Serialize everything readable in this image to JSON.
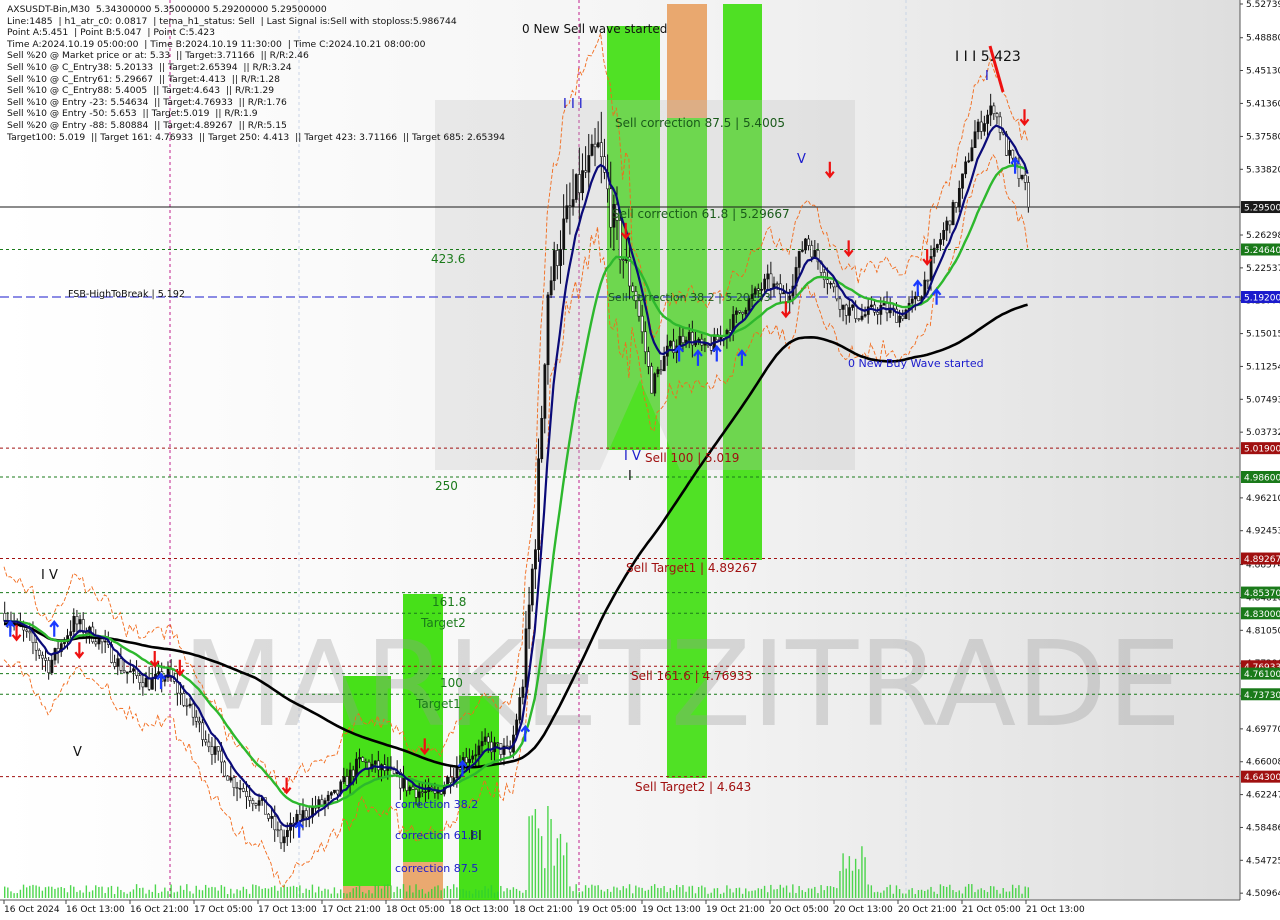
{
  "info_lines": [
    "AXSUSDT-Bin,M30  5.34300000 5.35000000 5.29200000 5.29500000",
    "Line:1485  | h1_atr_c0: 0.0817  | tema_h1_status: Sell  | Last Signal is:Sell with stoploss:5.986744",
    "Point A:5.451  | Point B:5.047  | Point C:5.423",
    "Time A:2024.10.19 05:00:00  | Time B:2024.10.19 11:30:00  | Time C:2024.10.21 08:00:00",
    "Sell %20 @ Market price or at: 5.33  || Target:3.71166  || R/R:2.46",
    "Sell %10 @ C_Entry38: 5.20133  || Target:2.65394  || R/R:3.24",
    "Sell %10 @ C_Entry61: 5.29667  || Target:4.413  || R/R:1.28",
    "Sell %10 @ C_Entry88: 5.4005  || Target:4.643  || R/R:1.29",
    "Sell %10 @ Entry -23: 5.54634  || Target:4.76933  || R/R:1.76",
    "Sell %10 @ Entry -50: 5.653  || Target:5.019  || R/R:1.9",
    "Sell %20 @ Entry -88: 5.80884  || Target:4.89267  || R/R:5.15",
    "Target100: 5.019  || Target 161: 4.76933  || Target 250: 4.413  || Target 423: 3.71166  || Target 685: 2.65394"
  ],
  "watermark": "MARKETZITRADE",
  "colors": {
    "green_line": "#2db82d",
    "navy_line": "#0a0a78",
    "black_line": "#000000",
    "red_level": "#a01010",
    "green_level": "#1a7a1a",
    "blue_level": "#1a1acc",
    "green_zone": "#33dd00",
    "orange_zone": "#e8a060",
    "buy_arrow": "#1a3aff",
    "sell_arrow": "#ee1111"
  },
  "chart_data": {
    "type": "candlestick",
    "symbol": "AXSUSDT-Bin",
    "timeframe": "M30",
    "current_price": "5.29500",
    "ylim": [
      4.5064,
      5.5274
    ],
    "y_ticks": [
      "5.52739",
      "5.48880",
      "5.45130",
      "5.41360",
      "5.37580",
      "5.33820",
      "5.26298",
      "5.22537",
      "5.18776",
      "5.15015",
      "5.11254",
      "5.07493",
      "5.03732",
      "4.96210",
      "4.92453",
      "4.88574",
      "4.84810",
      "4.81050",
      "4.77290",
      "4.73530",
      "4.69770",
      "4.66008",
      "4.62247",
      "4.58486",
      "4.54725",
      "4.50964"
    ],
    "x_ticks": [
      "16 Oct 2024",
      "16 Oct 13:00",
      "16 Oct 21:00",
      "17 Oct 05:00",
      "17 Oct 13:00",
      "17 Oct 21:00",
      "18 Oct 05:00",
      "18 Oct 13:00",
      "18 Oct 21:00",
      "19 Oct 05:00",
      "19 Oct 13:00",
      "19 Oct 21:00",
      "20 Oct 05:00",
      "20 Oct 13:00",
      "20 Oct 21:00",
      "21 Oct 05:00",
      "21 Oct 13:00"
    ],
    "levels": [
      {
        "price": 5.295,
        "label": "5.29500",
        "color": "#1a1a1a",
        "style": "solid"
      },
      {
        "price": 5.2464,
        "label": "5.24640",
        "color": "#1a7a1a",
        "style": "dashed"
      },
      {
        "price": 5.192,
        "label": "5.19200",
        "color": "#1a1acc",
        "style": "dashed"
      },
      {
        "price": 5.019,
        "label": "5.01900",
        "color": "#a01010",
        "style": "dashed"
      },
      {
        "price": 4.986,
        "label": "4.98600",
        "color": "#1a7a1a",
        "style": "dashed"
      },
      {
        "price": 4.89267,
        "label": "4.89267",
        "color": "#a01010",
        "style": "dashed"
      },
      {
        "price": 4.8537,
        "label": "4.85370",
        "color": "#1a7a1a",
        "style": "dashed"
      },
      {
        "price": 4.83,
        "label": "4.83000",
        "color": "#1a7a1a",
        "style": "dashed"
      },
      {
        "price": 4.76933,
        "label": "4.76933",
        "color": "#a01010",
        "style": "dashed"
      },
      {
        "price": 4.761,
        "label": "4.76100",
        "color": "#1a7a1a",
        "style": "dashed"
      },
      {
        "price": 4.7373,
        "label": "4.73730",
        "color": "#1a7a1a",
        "style": "dashed"
      },
      {
        "price": 4.643,
        "label": "4.64300",
        "color": "#a01010",
        "style": "dashed"
      }
    ],
    "annotations": [
      {
        "text": "0 New Sell wave started",
        "color": "#111111"
      },
      {
        "text": "Sell correction 87.5 | 5.4005",
        "color": "#1a5a1a"
      },
      {
        "text": "Sell correction 61.8 | 5.29667",
        "color": "#1a5a1a"
      },
      {
        "text": "Sell correction 38.2 | 5.20133",
        "color": "#1a5a1a"
      },
      {
        "text": "Sell 100 | 5.019",
        "color": "#a01010"
      },
      {
        "text": "Sell Target1 | 4.89267",
        "color": "#a01010"
      },
      {
        "text": "Sell 161.6 | 4.76933",
        "color": "#a01010"
      },
      {
        "text": "Sell Target2 | 4.643",
        "color": "#a01010"
      },
      {
        "text": "FSB-HighToBreak  |  5.192",
        "color": "#111111"
      },
      {
        "text": "0 New Buy Wave started",
        "color": "#1a1acc"
      },
      {
        "text": "I I I 5.423",
        "color": "#111111"
      },
      {
        "text": "423.6",
        "color": "#1a7a1a"
      },
      {
        "text": "250",
        "color": "#1a7a1a"
      },
      {
        "text": "161.8",
        "color": "#1a7a1a"
      },
      {
        "text": "Target2",
        "color": "#1a7a1a"
      },
      {
        "text": "100",
        "color": "#1a7a1a"
      },
      {
        "text": "Target1",
        "color": "#1a7a1a"
      },
      {
        "text": "correction 38.2",
        "color": "#1a1acc"
      },
      {
        "text": "correction 61.8",
        "color": "#1a1acc"
      },
      {
        "text": "correction 87.5",
        "color": "#1a1acc"
      },
      {
        "text": "I V",
        "color": "#111111"
      },
      {
        "text": "V",
        "color": "#111111"
      },
      {
        "text": "I I I",
        "color": "#1a1acc"
      },
      {
        "text": "V",
        "color": "#1a1acc"
      },
      {
        "text": "I V",
        "color": "#1a1acc"
      },
      {
        "text": "I",
        "color": "#1a1acc"
      },
      {
        "text": "I",
        "color": "#111111"
      },
      {
        "text": "I I",
        "color": "#111111"
      }
    ]
  }
}
